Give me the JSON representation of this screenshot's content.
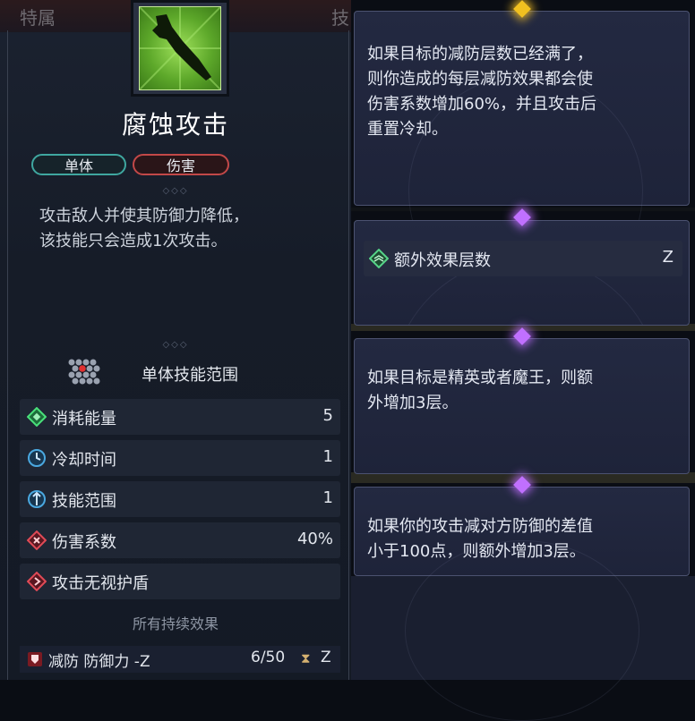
{
  "header": {
    "left_tab": "特属",
    "right_tab": "技"
  },
  "skill": {
    "icon": "corrosion-dagger-icon",
    "name": "腐蚀攻击",
    "tags": [
      "单体",
      "伤害"
    ],
    "description_lines": [
      "攻击敌人并使其防御力降低，",
      "该技能只会造成1次攻击。"
    ],
    "range_label": "单体技能范围",
    "stats": [
      {
        "label": "消耗能量",
        "value": "5",
        "icon": "energy-diamond-icon"
      },
      {
        "label": "冷却时间",
        "value": "1",
        "icon": "cooldown-clock-icon"
      },
      {
        "label": "技能范围",
        "value": "1",
        "icon": "range-target-icon"
      },
      {
        "label": "伤害系数",
        "value": "40%",
        "icon": "damage-ratio-icon"
      },
      {
        "label": "攻击无视护盾",
        "value": "",
        "icon": "shield-pierce-icon"
      }
    ],
    "all_effects_label": "所有持续效果",
    "buff": {
      "label": "减防",
      "effect": "防御力 -Z",
      "count": "6/50",
      "turns": "Z"
    }
  },
  "tooltips": [
    {
      "text_lines": [
        "如果目标的减防层数已经满了，",
        "则你造成的每层减防效果都会使",
        "伤害系数增加60%，并且攻击后",
        "重置冷却。"
      ],
      "gem": "#f0c020"
    },
    {
      "row_label": "额外效果层数",
      "row_value": "Z",
      "gem": "#c070ff"
    },
    {
      "text_lines": [
        "如果目标是精英或者魔王，则额",
        "外增加3层。"
      ],
      "gem": "#c070ff"
    },
    {
      "text_lines": [
        "如果你的攻击减对方防御的差值",
        "小于100点，则额外增加3层。"
      ],
      "gem": "#c070ff"
    }
  ],
  "colors": {
    "accent_green": "#7ccf3c",
    "tag_teal": "#3fa7a0",
    "tag_red": "#c24848",
    "gem_gold": "#f0c020",
    "gem_purple": "#c070ff"
  }
}
